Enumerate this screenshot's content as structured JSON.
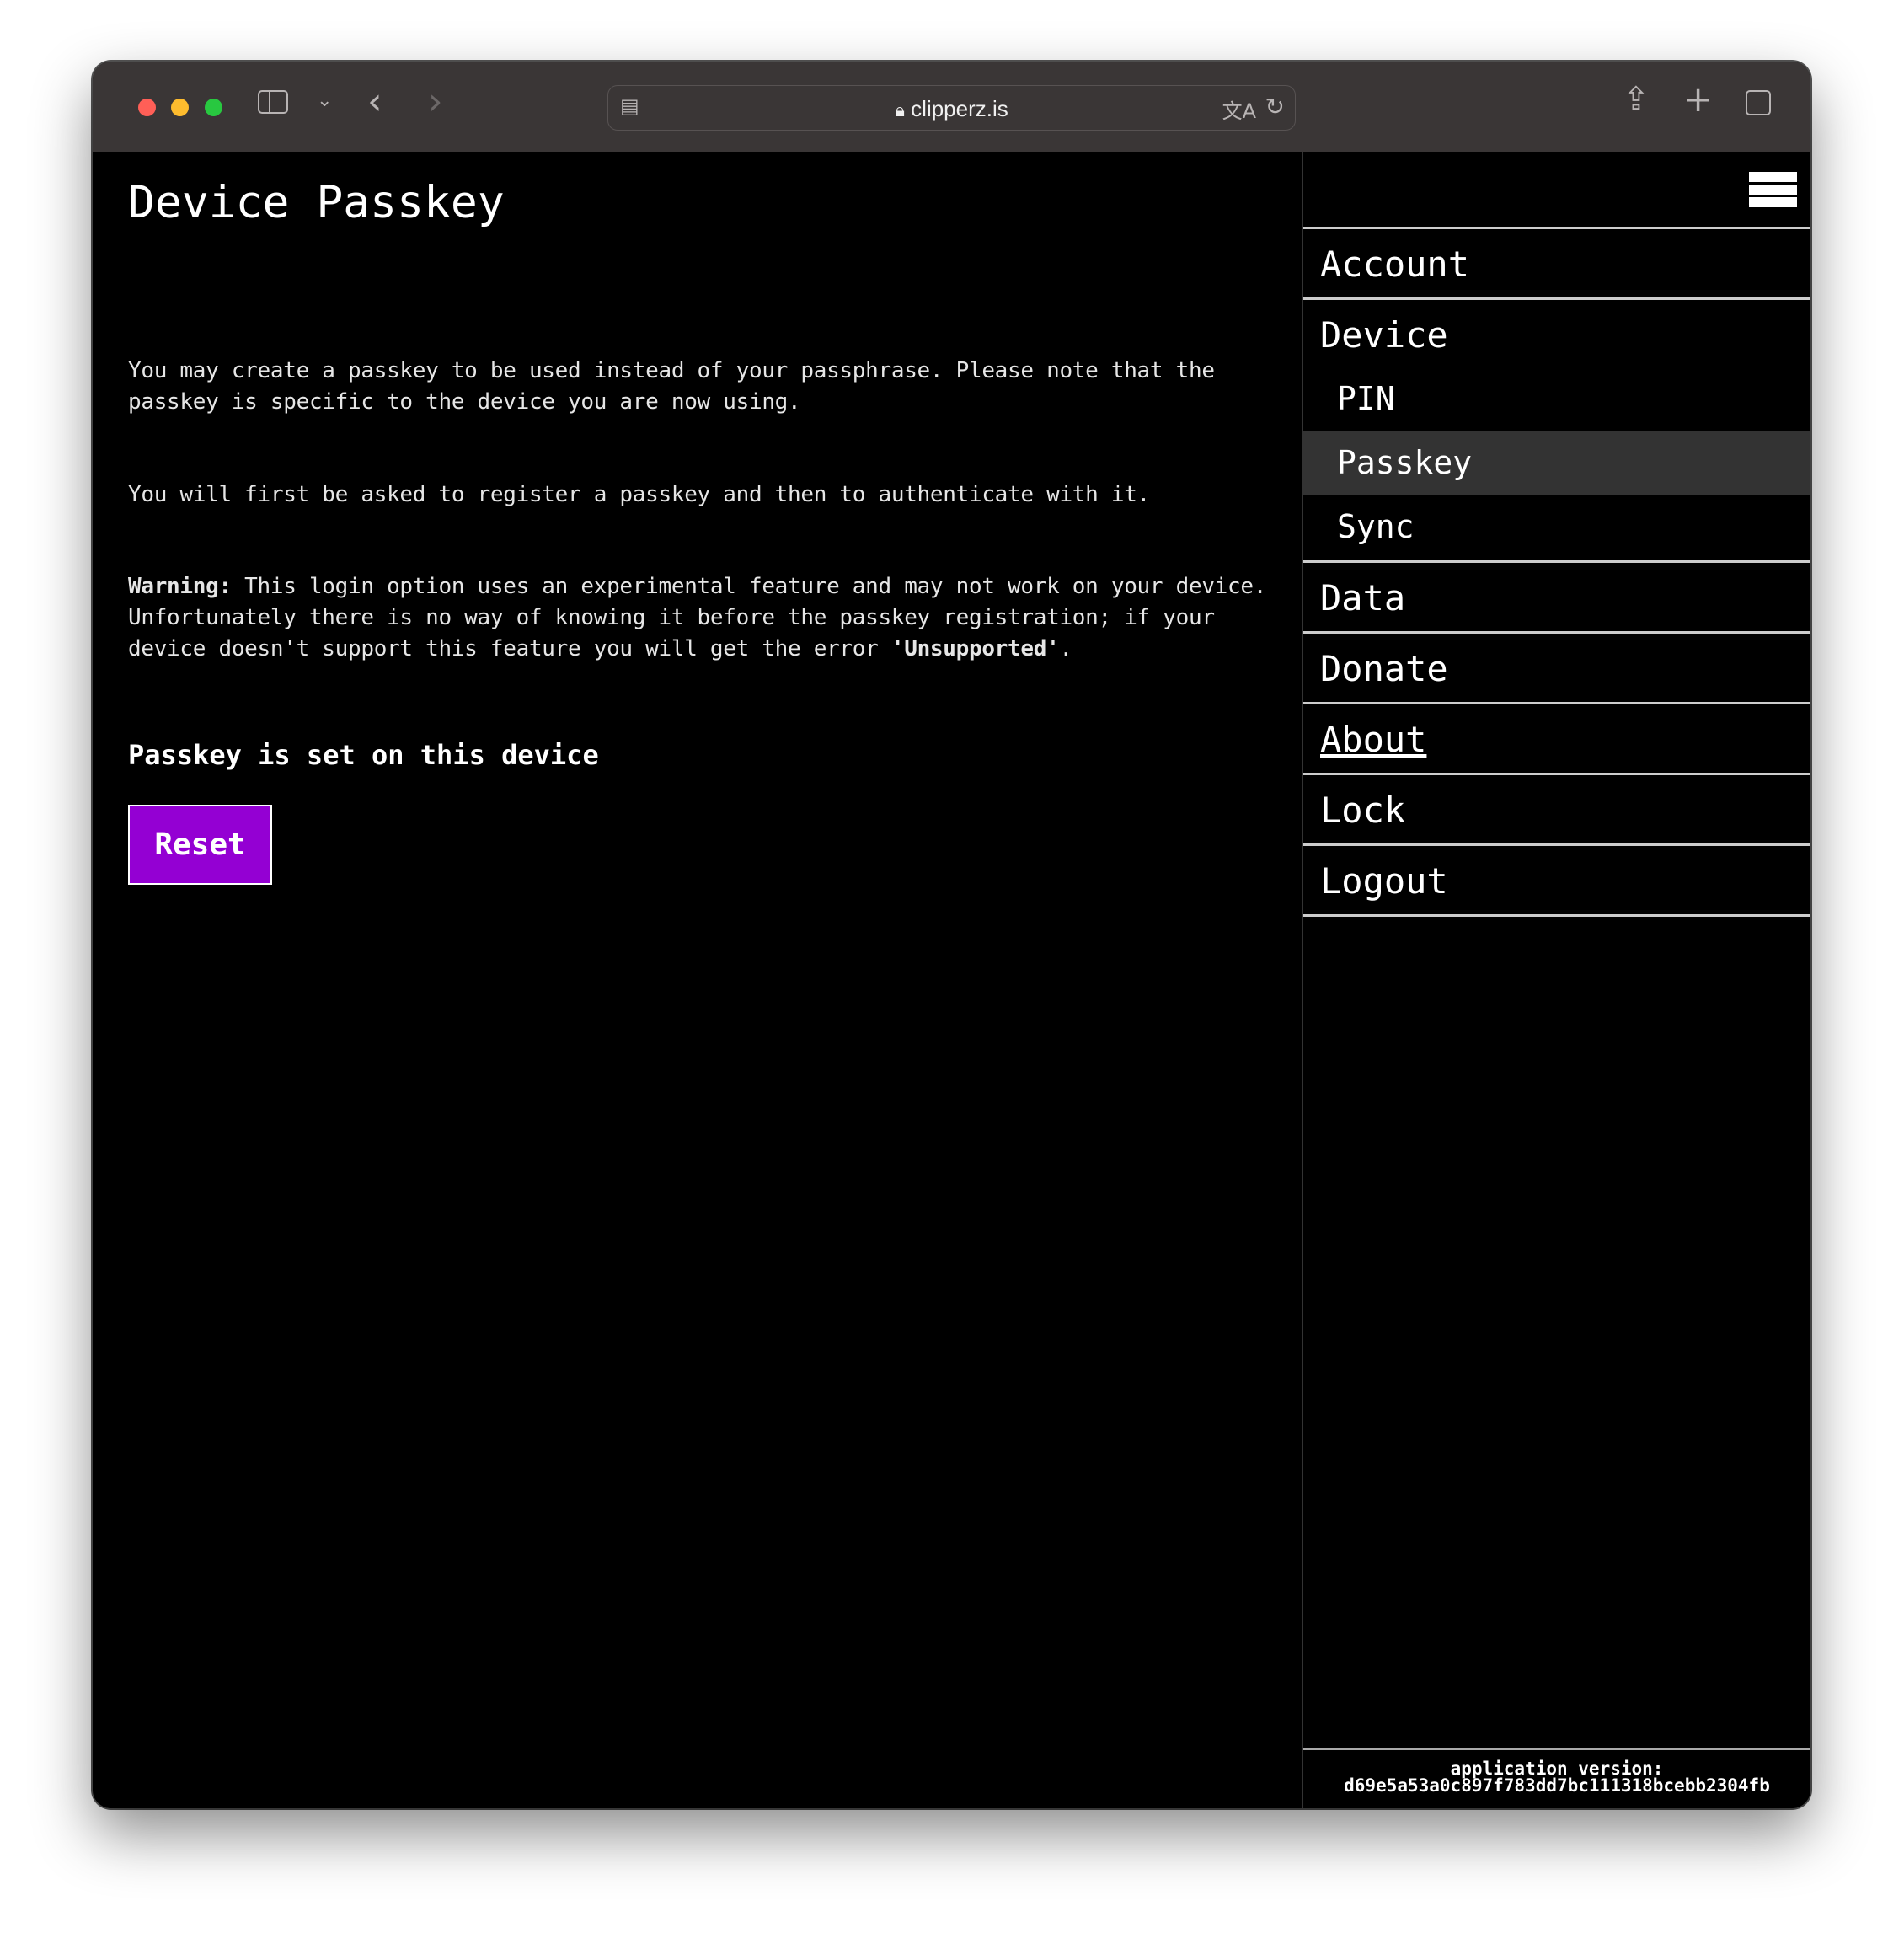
{
  "browser": {
    "url": "clipperz.is",
    "traffic_lights": {
      "close": "#ff5f57",
      "minimize": "#febc2e",
      "zoom": "#28c840"
    },
    "icons": [
      "sidebar-icon",
      "chevron-down-icon",
      "back-icon",
      "forward-icon",
      "page-menu-icon",
      "lock-icon",
      "translate-icon",
      "reload-icon",
      "share-icon",
      "new-tab-icon",
      "tabs-overview-icon"
    ]
  },
  "main": {
    "title": "Device Passkey",
    "paragraph1": "You may create a passkey to be used instead of your passphrase. Please note that the passkey is specific to the device you are now using.",
    "paragraph2": "You will first be asked to register a passkey and then to authenticate with it.",
    "warning_label": "Warning:",
    "warning_text_1": " This login option uses an experimental feature and may not work on your device. Unfortunately there is no way of knowing it before the passkey registration; if your device doesn't support this feature you will get the error ",
    "warning_error": "'Unsupported'",
    "warning_text_2": ".",
    "status": "Passkey is set on this device",
    "reset_label": "Reset",
    "accent_color": "#9400d3"
  },
  "sidebar": {
    "items": [
      {
        "label": "Account"
      },
      {
        "label": "Device"
      },
      {
        "label": "Data"
      },
      {
        "label": "Donate"
      },
      {
        "label": "About"
      },
      {
        "label": "Lock"
      },
      {
        "label": "Logout"
      }
    ],
    "device_sub": [
      {
        "label": "PIN"
      },
      {
        "label": "Passkey",
        "active": true
      },
      {
        "label": "Sync"
      }
    ],
    "footer_label": "application version:",
    "footer_version": "d69e5a53a0c897f783dd7bc111318bcebb2304fb"
  }
}
